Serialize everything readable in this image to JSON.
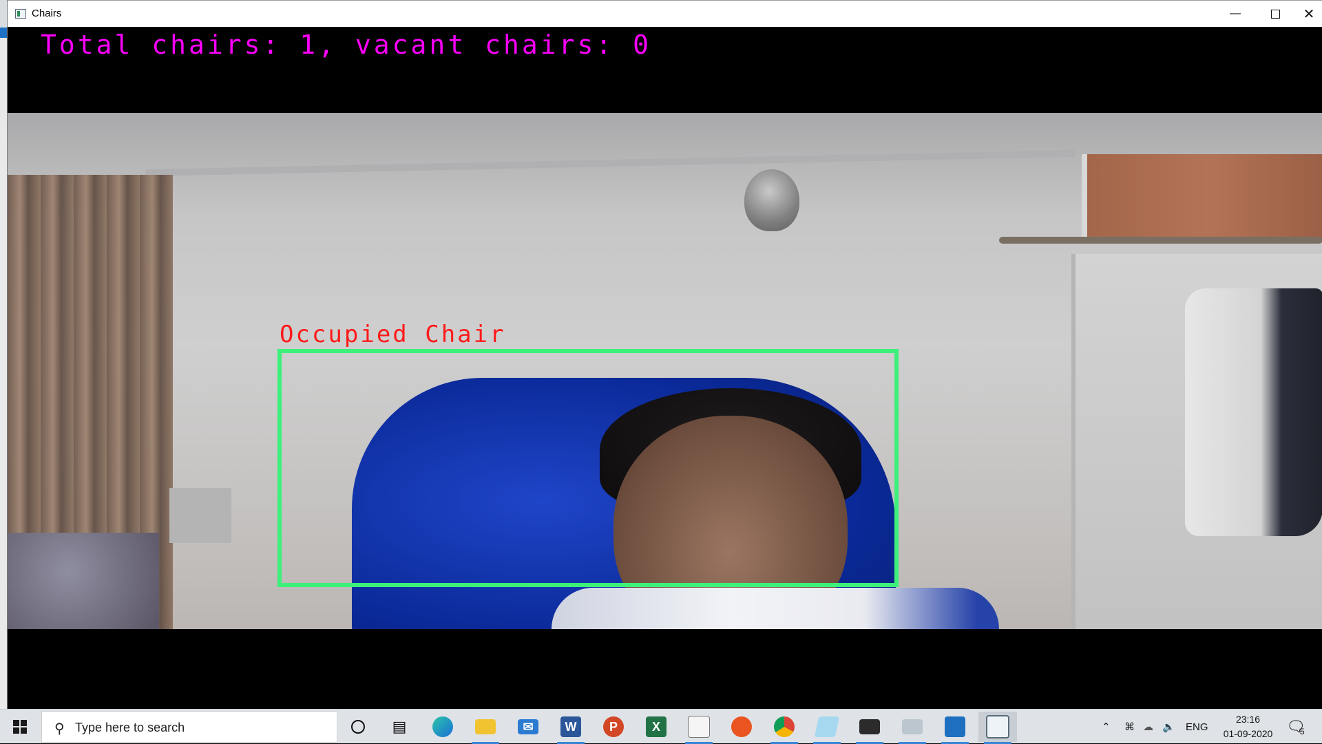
{
  "window": {
    "title": "Chairs",
    "minimize_icon": "minimize-icon",
    "maximize_icon": "maximize-icon",
    "close_icon": "close-icon"
  },
  "overlay": {
    "summary": "Total chairs: 1, vacant chairs: 0",
    "detection_label": "Occupied Chair",
    "summary_color": "#ff00ff",
    "label_color": "#ff1a1a",
    "box_color": "#3cf07a"
  },
  "taskbar": {
    "search_placeholder": "Type here to search",
    "apps": [
      {
        "name": "cortana",
        "icon": "circle-icon"
      },
      {
        "name": "task-view",
        "icon": "task-view-icon"
      },
      {
        "name": "edge",
        "icon": "edge-icon"
      },
      {
        "name": "file-explorer",
        "icon": "folder-icon"
      },
      {
        "name": "mail",
        "icon": "mail-icon"
      },
      {
        "name": "word",
        "icon": "word-icon",
        "letter": "W"
      },
      {
        "name": "powerpoint",
        "icon": "powerpoint-icon",
        "letter": "P"
      },
      {
        "name": "excel",
        "icon": "excel-icon",
        "letter": "X"
      },
      {
        "name": "python-file",
        "icon": "python-file-icon"
      },
      {
        "name": "ubuntu",
        "icon": "ubuntu-icon"
      },
      {
        "name": "chrome",
        "icon": "chrome-icon"
      },
      {
        "name": "notepad",
        "icon": "notepad-icon"
      },
      {
        "name": "terminal",
        "icon": "terminal-icon"
      },
      {
        "name": "scanner",
        "icon": "scanner-icon"
      },
      {
        "name": "photos",
        "icon": "photos-icon"
      },
      {
        "name": "chairs-app",
        "icon": "chairs-app-icon"
      }
    ],
    "tray": {
      "language": "ENG",
      "time": "23:16",
      "date": "01-09-2020",
      "notification_count": "5"
    }
  }
}
